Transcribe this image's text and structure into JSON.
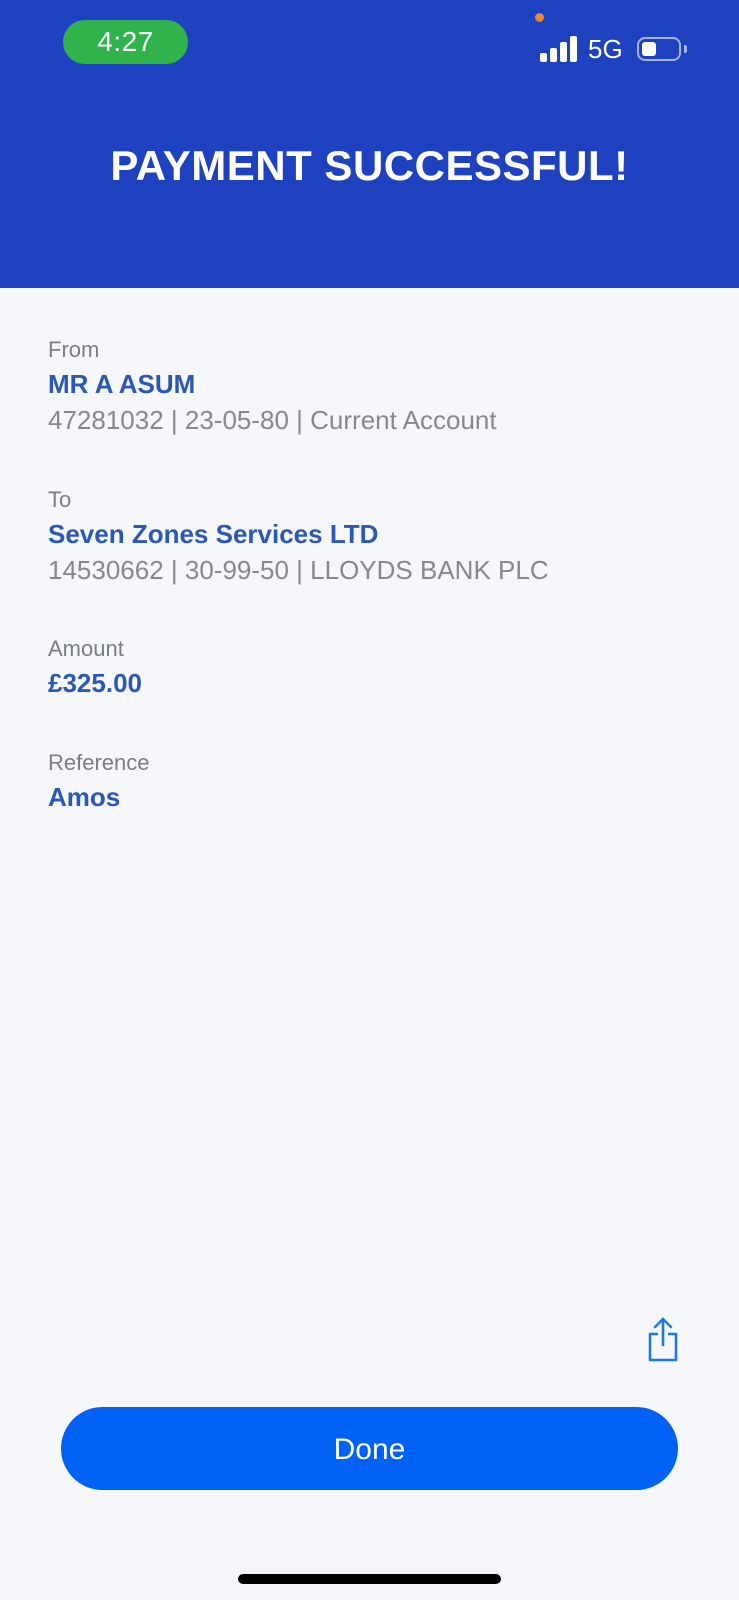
{
  "status_bar": {
    "time": "4:27",
    "network": "5G",
    "signal_bars_filled": 4,
    "battery_level": 0.4,
    "privacy_dot_color": "#e8883a",
    "time_pill_color": "#2fb34a"
  },
  "header": {
    "title": "PAYMENT SUCCESSFUL!",
    "background_color": "#1e42bf"
  },
  "details": {
    "from": {
      "label": "From",
      "name": "MR A ASUM",
      "info": "47281032 | 23-05-80 | Current Account"
    },
    "to": {
      "label": "To",
      "name": "Seven Zones Services LTD",
      "info": "14530662 | 30-99-50 | LLOYDS BANK PLC"
    },
    "amount": {
      "label": "Amount",
      "value": "£325.00"
    },
    "reference": {
      "label": "Reference",
      "value": "Amos"
    }
  },
  "actions": {
    "share_icon": "share-icon",
    "done_label": "Done",
    "accent_color": "#0062f5"
  }
}
